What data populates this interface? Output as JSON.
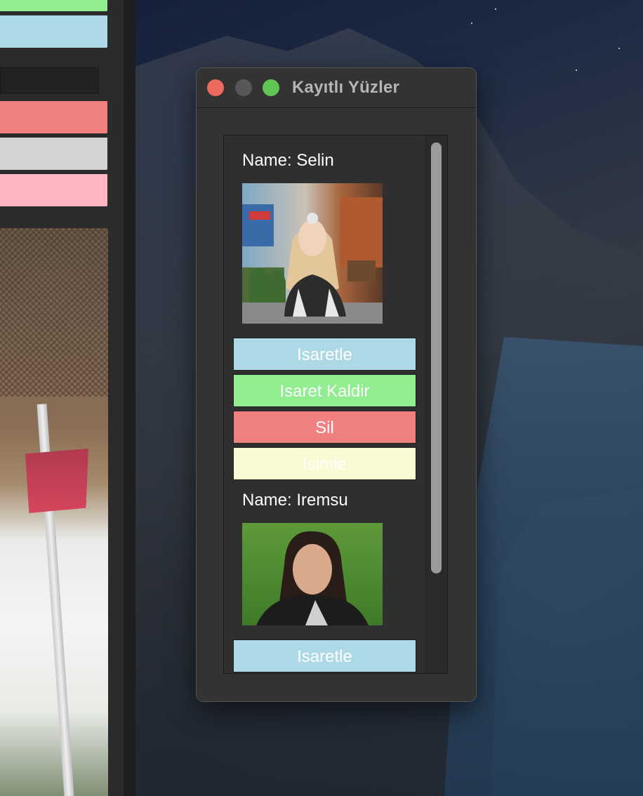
{
  "window": {
    "title": "Kayıtlı Yüzler"
  },
  "faces": [
    {
      "name_label": "Name: Selin",
      "buttons": {
        "mark": "Isaretle",
        "unmark": "Isaret Kaldir",
        "delete": "Sil",
        "rename": "Isimle"
      }
    },
    {
      "name_label": "Name: Iremsu",
      "buttons": {
        "mark": "Isaretle"
      }
    }
  ],
  "colors": {
    "mark_button": "#add8e6",
    "unmark_button": "#90ee90",
    "delete_button": "#f08080",
    "rename_button": "#fafad2",
    "left_app_bars": [
      "#90ee90",
      "#add8e6",
      "#f08080",
      "#d3d3d3",
      "#ffb6c1"
    ]
  }
}
